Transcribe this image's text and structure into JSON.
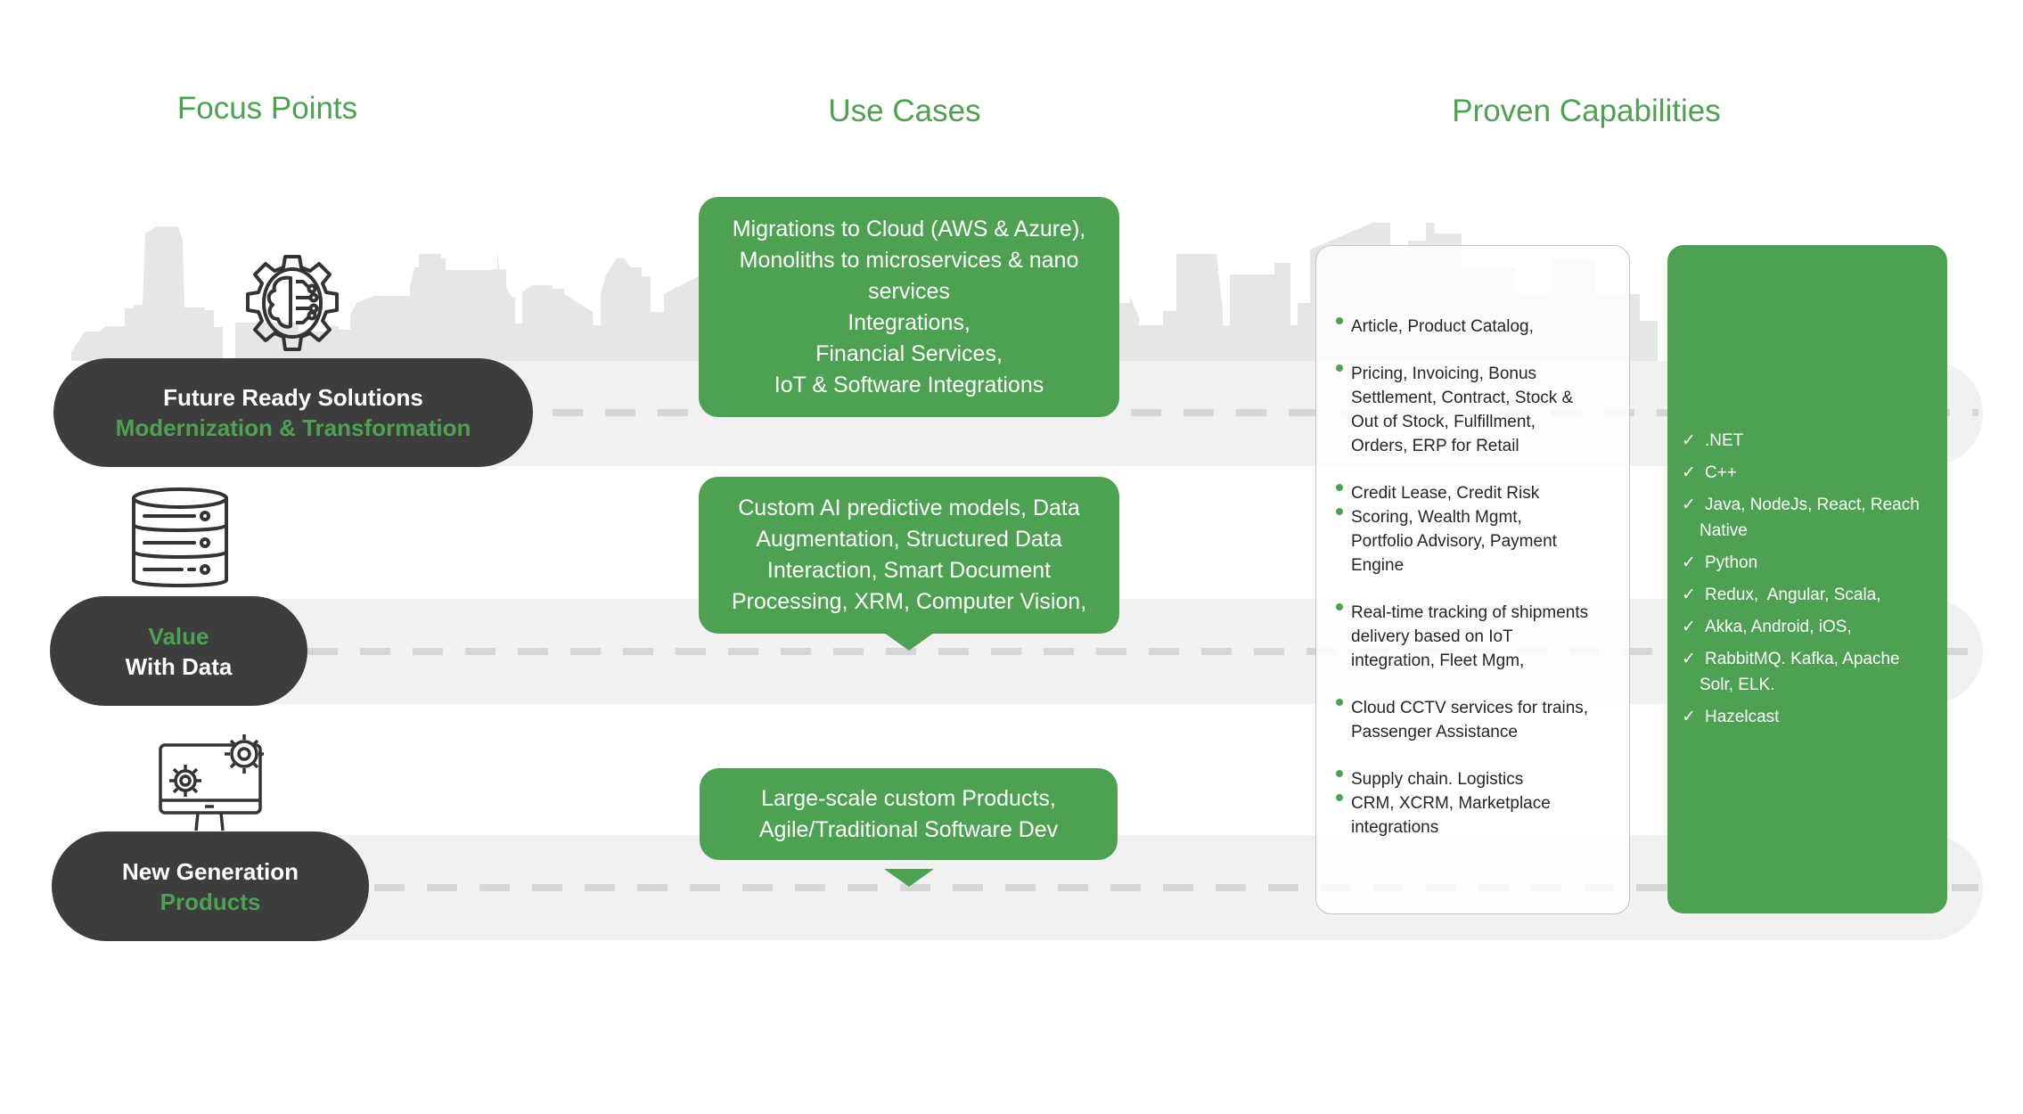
{
  "colors": {
    "accent_green": "#4ea152",
    "pill_dark": "#3d3d3d",
    "band_gray": "#f1f1f1",
    "skyline_gray": "#e6e6e6",
    "dash_gray": "#d6d6d6"
  },
  "headers": {
    "focus_points": "Focus Points",
    "use_cases": "Use Cases",
    "proven_capabilities": "Proven Capabilities"
  },
  "focus_points": [
    {
      "icon": "brain-gear-icon",
      "line1": "Future Ready Solutions",
      "line2": "Modernization & Transformation"
    },
    {
      "icon": "database-icon",
      "line1": "Value",
      "line2": "With Data"
    },
    {
      "icon": "monitor-gears-icon",
      "line1": "New Generation",
      "line2": "Products"
    }
  ],
  "use_cases": [
    {
      "lines": [
        "Migrations to Cloud (AWS & Azure),",
        "Monoliths to microservices & nano",
        "services",
        "Integrations,",
        "Financial Services,",
        "IoT & Software Integrations"
      ]
    },
    {
      "lines": [
        "Custom AI predictive models, Data",
        "Augmentation, Structured Data",
        "Interaction, Smart Document",
        "Processing, XRM, Computer Vision,"
      ]
    },
    {
      "lines": [
        "Large-scale custom Products,",
        "Agile/Traditional Software Dev"
      ]
    }
  ],
  "domains_list": [
    [
      "Article, Product Catalog,"
    ],
    [
      "Pricing, Invoicing, Bonus",
      "Settlement, Contract, Stock &",
      "Out of Stock, Fulfillment,",
      "Orders, ERP for Retail"
    ],
    [
      "Credit Lease, Credit Risk"
    ],
    [
      "Scoring, Wealth Mgmt,",
      "Portfolio Advisory, Payment",
      "Engine"
    ],
    [
      "Real-time tracking of shipments",
      "delivery based on IoT",
      "integration, Fleet Mgm,"
    ],
    [
      "Cloud CCTV services for trains,",
      "Passenger Assistance"
    ],
    [
      "Supply chain. Logistics"
    ],
    [
      "CRM, XCRM, Marketplace",
      "integrations"
    ]
  ],
  "capabilities": {
    "check_icon": "✓",
    "items": [
      [
        ".NET"
      ],
      [
        "C++"
      ],
      [
        "Java, NodeJs, React, Reach",
        "Native"
      ],
      [
        "Python"
      ],
      [
        "Redux,  Angular, Scala,"
      ],
      [
        "Akka, Android, iOS,"
      ],
      [
        "RabbitMQ. Kafka, Apache",
        "Solr, ELK."
      ],
      [
        "Hazelcast"
      ]
    ]
  }
}
